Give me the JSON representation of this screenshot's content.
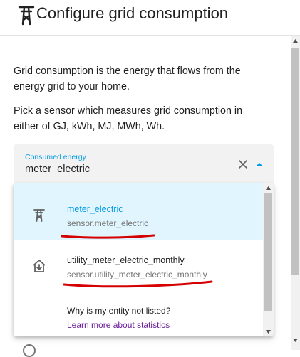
{
  "dialog": {
    "title": "Configure grid consumption",
    "title_icon": "transmission-tower-icon"
  },
  "description": {
    "paragraph1": "Grid consumption is the energy that flows from the energy grid to your home.",
    "paragraph2": "Pick a sensor which measures grid consumption in either of GJ, kWh, MJ, MWh, Wh."
  },
  "field": {
    "label": "Consumed energy",
    "value": "meter_electric",
    "clear_icon": "close-icon",
    "toggle_icon": "arrow-up-icon"
  },
  "options": [
    {
      "name": "meter_electric",
      "entity_id": "sensor.meter_electric",
      "icon": "transmission-tower-icon",
      "selected": true
    },
    {
      "name": "utility_meter_electric_monthly",
      "entity_id": "sensor.utility_meter_electric_monthly",
      "icon": "home-import-icon",
      "selected": false
    }
  ],
  "help": {
    "question": "Why is my entity not listed?",
    "link": "Learn more about statistics"
  },
  "colors": {
    "accent": "#039be5",
    "selected_bg": "#e1f5fe",
    "link": "#6a1b9a",
    "annotation": "#d50000"
  }
}
